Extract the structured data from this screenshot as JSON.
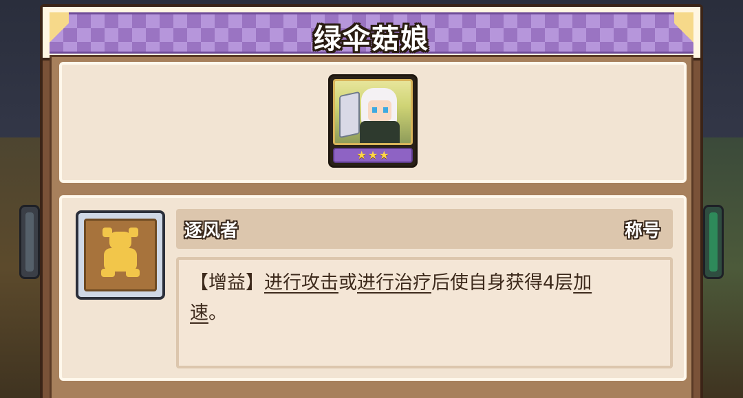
{
  "dialog": {
    "title": "绿伞菇娘"
  },
  "character": {
    "stars": [
      "★",
      "★",
      "★"
    ]
  },
  "skill": {
    "name": "逐风者",
    "tag": "称号",
    "description": {
      "prefix": "【增益】",
      "kw1": "进行攻击",
      "or": "或",
      "kw2": "进行治疗",
      "mid": "后使自身获得4层",
      "kw3a": "加",
      "kw3b": "速",
      "end": "。"
    }
  },
  "colors": {
    "title_banner": "#9a74c2",
    "panel_bg": "#f2e4d3",
    "frame_brown": "#7a5238",
    "star_bar": "#8e63c4",
    "skill_icon_gold": "#f2c64a"
  }
}
